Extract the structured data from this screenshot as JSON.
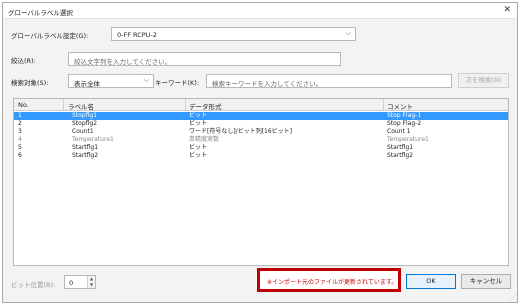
{
  "window": {
    "title": "グローバルラベル選択"
  },
  "global_label_setting": {
    "label": "グローバルラベル設定(G):",
    "value": "0-FF RCPU-2"
  },
  "filter": {
    "label": "絞込(R):",
    "placeholder": "絞込文字列を入力してください。"
  },
  "search": {
    "target_label": "検索対象(S):",
    "target_value": "表示全体",
    "keyword_label": "キーワード(K):",
    "keyword_placeholder": "検索キーワードを入力してください。",
    "next_button": "次を検索(N)"
  },
  "table": {
    "columns": [
      "No.",
      "ラベル名",
      "データ形式",
      "コメント"
    ],
    "rows": [
      {
        "no": "1",
        "label": "Stopflg1",
        "type": "ビット",
        "comment": "Stop Flag-1",
        "selected": true,
        "dim": false
      },
      {
        "no": "2",
        "label": "Stopflg2",
        "type": "ビット",
        "comment": "Stop Flag-2",
        "selected": false,
        "dim": false
      },
      {
        "no": "3",
        "label": "Count1",
        "type": "ワード[符号なし]/ビット列[16ビット]",
        "comment": "Count 1",
        "selected": false,
        "dim": false
      },
      {
        "no": "4",
        "label": "Temperature1",
        "type": "単精度実数",
        "comment": "Temperature1",
        "selected": false,
        "dim": true
      },
      {
        "no": "5",
        "label": "Startflg1",
        "type": "ビット",
        "comment": "Startflg1",
        "selected": false,
        "dim": false
      },
      {
        "no": "6",
        "label": "Startflg2",
        "type": "ビット",
        "comment": "Startflg2",
        "selected": false,
        "dim": false
      }
    ]
  },
  "footer": {
    "bit_position_label": "ビット位置(B):",
    "bit_position_value": "0",
    "notice": "※インポート元のファイルが更新されています。",
    "ok_button": "OK",
    "cancel_button": "キャンセル"
  },
  "colors": {
    "selection": "#3399ff",
    "notice_border": "#c00000",
    "notice_text": "#d00000"
  }
}
